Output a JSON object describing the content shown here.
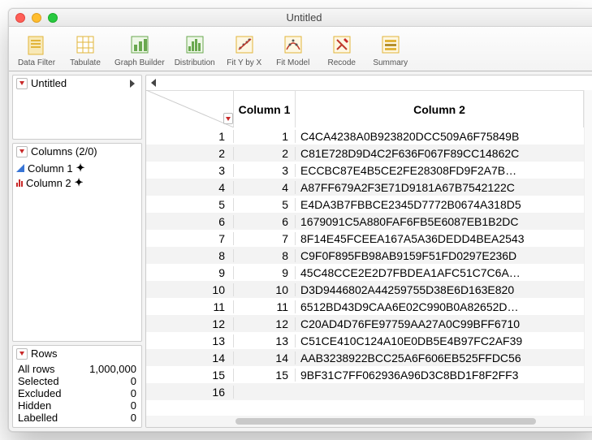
{
  "window": {
    "title": "Untitled"
  },
  "toolbar": [
    {
      "id": "data-filter",
      "label": "Data Filter"
    },
    {
      "id": "tabulate",
      "label": "Tabulate"
    },
    {
      "id": "graph-builder",
      "label": "Graph Builder"
    },
    {
      "id": "distribution",
      "label": "Distribution"
    },
    {
      "id": "fit-y-by-x",
      "label": "Fit Y by X"
    },
    {
      "id": "fit-model",
      "label": "Fit Model"
    },
    {
      "id": "recode",
      "label": "Recode"
    },
    {
      "id": "summary",
      "label": "Summary"
    }
  ],
  "source_panel": {
    "title": "Untitled"
  },
  "columns_panel": {
    "title": "Columns (2/0)",
    "items": [
      {
        "name": "Column 1",
        "type": "continuous"
      },
      {
        "name": "Column 2",
        "type": "nominal"
      }
    ]
  },
  "rows_panel": {
    "title": "Rows",
    "stats": {
      "all_label": "All rows",
      "all_value": "1,000,000",
      "sel_label": "Selected",
      "sel_value": "0",
      "exc_label": "Excluded",
      "exc_value": "0",
      "hid_label": "Hidden",
      "hid_value": "0",
      "lab_label": "Labelled",
      "lab_value": "0"
    }
  },
  "table": {
    "headers": {
      "col1": "Column 1",
      "col2": "Column 2"
    },
    "rows": [
      {
        "n": "1",
        "c1": "1",
        "c2": "C4CA4238A0B923820DCC509A6F75849B"
      },
      {
        "n": "2",
        "c1": "2",
        "c2": "C81E728D9D4C2F636F067F89CC14862C"
      },
      {
        "n": "3",
        "c1": "3",
        "c2": "ECCBC87E4B5CE2FE28308FD9F2A7B…"
      },
      {
        "n": "4",
        "c1": "4",
        "c2": "A87FF679A2F3E71D9181A67B7542122C"
      },
      {
        "n": "5",
        "c1": "5",
        "c2": "E4DA3B7FBBCE2345D7772B0674A318D5"
      },
      {
        "n": "6",
        "c1": "6",
        "c2": "1679091C5A880FAF6FB5E6087EB1B2DC"
      },
      {
        "n": "7",
        "c1": "7",
        "c2": "8F14E45FCEEA167A5A36DEDD4BEA2543"
      },
      {
        "n": "8",
        "c1": "8",
        "c2": "C9F0F895FB98AB9159F51FD0297E236D"
      },
      {
        "n": "9",
        "c1": "9",
        "c2": "45C48CCE2E2D7FBDEA1AFC51C7C6A…"
      },
      {
        "n": "10",
        "c1": "10",
        "c2": "D3D9446802A44259755D38E6D163E820"
      },
      {
        "n": "11",
        "c1": "11",
        "c2": "6512BD43D9CAA6E02C990B0A82652D…"
      },
      {
        "n": "12",
        "c1": "12",
        "c2": "C20AD4D76FE97759AA27A0C99BFF6710"
      },
      {
        "n": "13",
        "c1": "13",
        "c2": "C51CE410C124A10E0DB5E4B97FC2AF39"
      },
      {
        "n": "14",
        "c1": "14",
        "c2": "AAB3238922BCC25A6F606EB525FFDC56"
      },
      {
        "n": "15",
        "c1": "15",
        "c2": "9BF31C7FF062936A96D3C8BD1F8F2FF3"
      },
      {
        "n": "16",
        "c1": "",
        "c2": ""
      }
    ]
  },
  "icons": {
    "data-filter": "#e2b53a",
    "tabulate": "#e2b53a",
    "graph-builder": "#6aa84f",
    "distribution": "#6aa84f",
    "fit-y-by-x": "#e2b53a",
    "fit-model": "#e2b53a",
    "recode": "#e2b53a",
    "summary": "#e2b53a"
  }
}
